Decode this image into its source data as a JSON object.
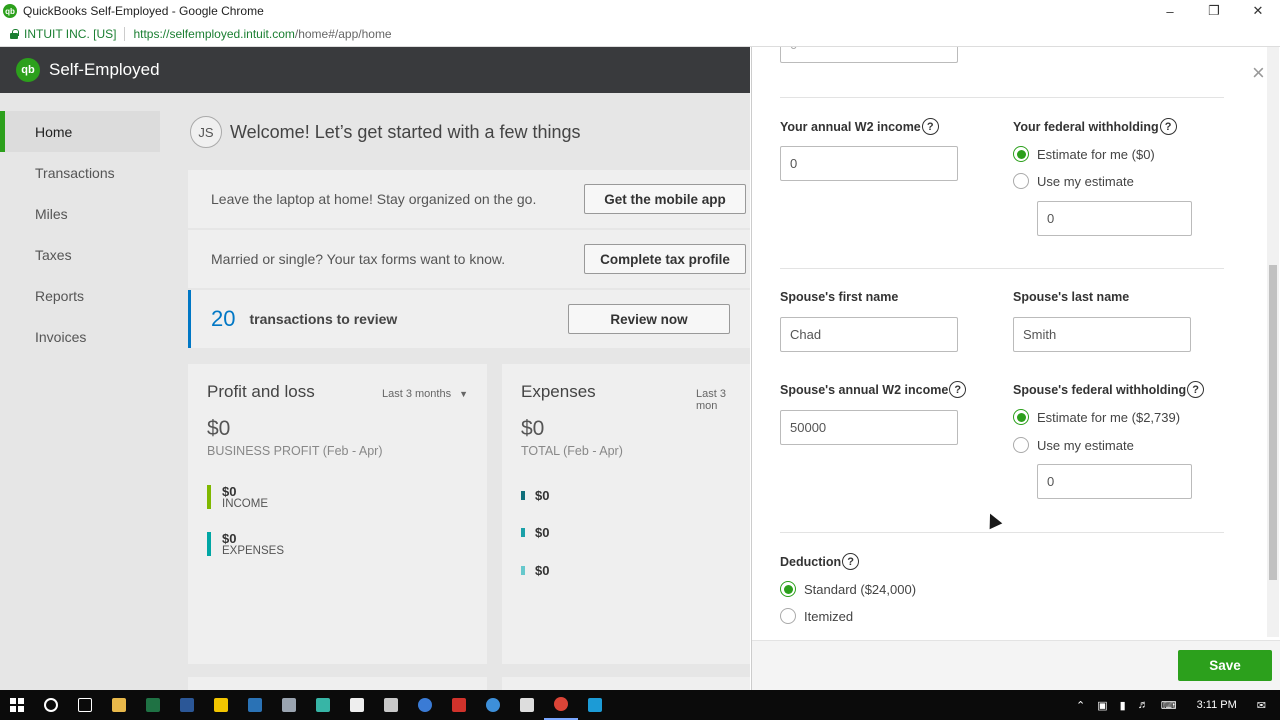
{
  "browser": {
    "window_title": "QuickBooks Self-Employed - Google Chrome",
    "org": "INTUIT INC. [US]",
    "url_host": "https://selfemployed.intuit.com",
    "url_path": "/home#/app/home"
  },
  "app": {
    "brand": "Self-Employed",
    "logo": "qb"
  },
  "sidebar": {
    "items": [
      {
        "label": "Home",
        "active": true
      },
      {
        "label": "Transactions"
      },
      {
        "label": "Miles"
      },
      {
        "label": "Taxes"
      },
      {
        "label": "Reports"
      },
      {
        "label": "Invoices"
      }
    ]
  },
  "welcome": {
    "initials": "JS",
    "text": "Welcome! Let’s get started with a few things"
  },
  "tasks": [
    {
      "message": "Leave the laptop at home! Stay organized on the go.",
      "button": "Get the mobile app"
    },
    {
      "message": "Married or single? Your tax forms want to know.",
      "button": "Complete tax profile"
    },
    {
      "count": "20",
      "message": "transactions to review",
      "button": "Review now"
    }
  ],
  "profit_loss": {
    "title": "Profit and loss",
    "range": "Last 3 months",
    "amount": "$0",
    "subtitle": "BUSINESS PROFIT (Feb - Apr)",
    "income_value": "$0",
    "income_label": "INCOME",
    "expenses_value": "$0",
    "expenses_label": "EXPENSES",
    "income_color": "#7fb800",
    "expenses_color": "#00a6a4"
  },
  "expenses": {
    "title": "Expenses",
    "range": "Last 3 mon",
    "amount": "$0",
    "subtitle": "TOTAL (Feb - Apr)",
    "items": [
      "$0",
      "$0",
      "$0"
    ],
    "colors": [
      "#0f6e7a",
      "#1aa0a8",
      "#66c8cc"
    ]
  },
  "drawer": {
    "w2_label": "Your annual W2 income",
    "w2_value": "0",
    "fed_label": "Your federal withholding",
    "fed_opt1": "Estimate for me ($0)",
    "fed_opt2": "Use my estimate",
    "fed_estimate_value": "0",
    "spouse_first_label": "Spouse's first name",
    "spouse_first_value": "Chad",
    "spouse_last_label": "Spouse's last name",
    "spouse_last_value": "Smith",
    "spouse_w2_label": "Spouse's annual W2 income",
    "spouse_w2_value": "50000",
    "spouse_fed_label": "Spouse's federal withholding",
    "spouse_fed_opt1": "Estimate for me ($2,739)",
    "spouse_fed_opt2": "Use my estimate",
    "spouse_fed_estimate_value": "0",
    "deduction_label": "Deduction",
    "deduction_opt1": "Standard ($24,000)",
    "deduction_opt2": "Itemized",
    "top_partial_value": "0",
    "help_glyph": "?",
    "save": "Save",
    "close_glyph": "×"
  },
  "taskbar": {
    "time": "3:11 PM"
  }
}
